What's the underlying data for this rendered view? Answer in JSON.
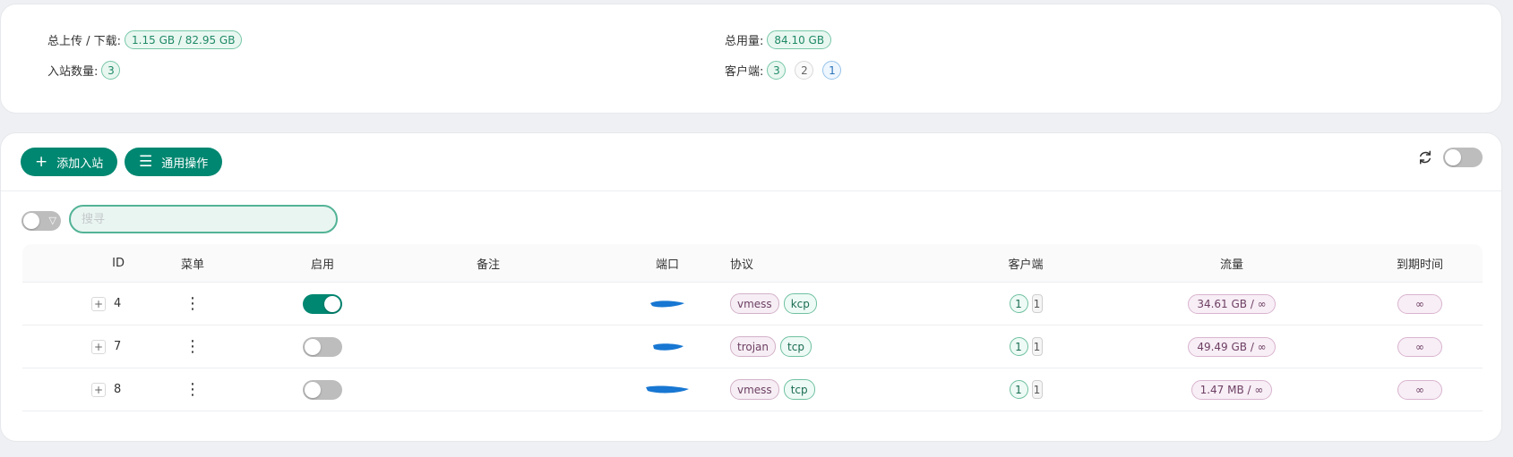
{
  "stats": {
    "upload_download_label": "总上传 / 下载:",
    "upload_download_value": "1.15 GB / 82.95 GB",
    "total_usage_label": "总用量:",
    "total_usage_value": "84.10 GB",
    "inbound_count_label": "入站数量:",
    "inbound_count_value": "3",
    "clients_label": "客户端:",
    "clients_counts": [
      "3",
      "2",
      "1"
    ]
  },
  "toolbar": {
    "add_inbound_label": "添加入站",
    "general_actions_label": "通用操作",
    "auto_refresh_enabled": false
  },
  "search": {
    "placeholder": "搜寻",
    "value": ""
  },
  "table": {
    "headers": {
      "id": "ID",
      "menu": "菜单",
      "enable": "启用",
      "remark": "备注",
      "port": "端口",
      "protocol": "协议",
      "clients": "客户端",
      "traffic": "流量",
      "expiry": "到期时间"
    },
    "rows": [
      {
        "id": "4",
        "enabled": true,
        "remark": "",
        "protocol": "vmess",
        "network": "kcp",
        "clients_a": "1",
        "clients_b": "1",
        "traffic": "34.61 GB / ∞",
        "expiry": "∞"
      },
      {
        "id": "7",
        "enabled": false,
        "remark": "",
        "protocol": "trojan",
        "network": "tcp",
        "clients_a": "1",
        "clients_b": "1",
        "traffic": "49.49 GB / ∞",
        "expiry": "∞"
      },
      {
        "id": "8",
        "enabled": false,
        "remark": "",
        "protocol": "vmess",
        "network": "tcp",
        "clients_a": "1",
        "clients_b": "1",
        "traffic": "1.47 MB / ∞",
        "expiry": "∞"
      }
    ]
  },
  "icons": {
    "add": "plus-icon",
    "menu": "list-icon",
    "refresh": "refresh-icon",
    "filter": "filter-icon",
    "expand": "expand-icon",
    "kebab": "kebab-icon"
  },
  "colors": {
    "accent": "#008771",
    "toggle_off": "#bdbdbd",
    "redaction": "#1877d2"
  }
}
